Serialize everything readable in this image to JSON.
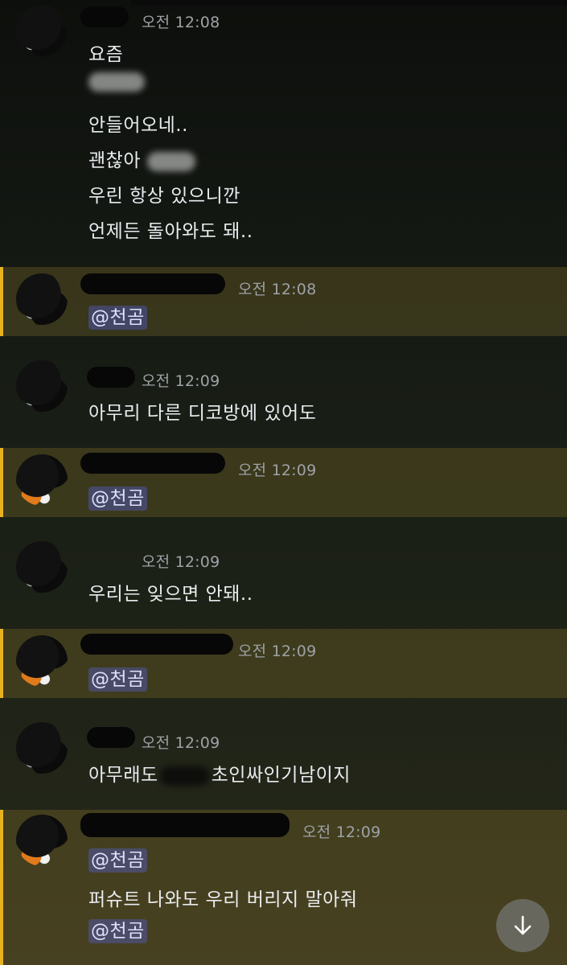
{
  "colors": {
    "mention_highlight": "#e8b21f",
    "mention_tag_bg": "#5865f2",
    "text": "#e9ecef",
    "timestamp": "#9ea2a6"
  },
  "messages": [
    {
      "time": "오전 12:08",
      "lines": [
        "요즘",
        "",
        "안들어오네..",
        "괜찮아",
        "우린 항상 있으니깐",
        "언제든 돌아와도 돼.."
      ]
    },
    {
      "time": "오전 12:08",
      "mention": "@천곰"
    },
    {
      "time": "오전 12:09",
      "text": "아무리 다른 디코방에 있어도"
    },
    {
      "time": "오전 12:09",
      "mention": "@천곰"
    },
    {
      "time": "오전 12:09",
      "text": "우리는 잊으면 안돼.."
    },
    {
      "time": "오전 12:09",
      "mention": "@천곰"
    },
    {
      "time": "오전 12:09",
      "text_before": "아무래도",
      "text_after": "초인싸인기남이지"
    },
    {
      "time": "오전 12:09",
      "mention1": "@천곰",
      "text": "퍼슈트 나와도 우리 버리지 말아줘",
      "mention2": "@천곰"
    }
  ],
  "scroll_button": {
    "icon": "arrow-down-icon"
  }
}
